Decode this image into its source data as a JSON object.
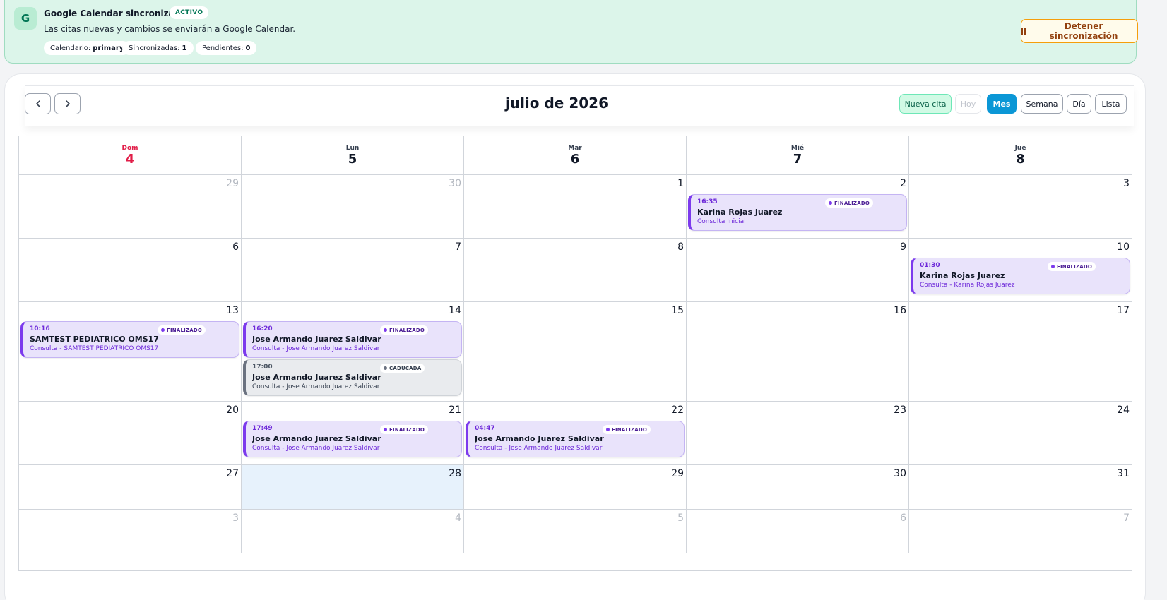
{
  "sync": {
    "avatar_letter": "G",
    "title": "Google Calendar sincronizando",
    "badge": "ACTIVO",
    "description": "Las citas nuevas y cambios se enviarán a Google Calendar.",
    "chips": [
      {
        "label": "Calendario:",
        "value": "primary"
      },
      {
        "label": "Sincronizadas:",
        "value": "1"
      },
      {
        "label": "Pendientes:",
        "value": "0"
      }
    ],
    "stop_label": "Detener sincronización"
  },
  "toolbar": {
    "title": "julio de 2026",
    "new_label": "Nueva cita",
    "today_label": "Hoy",
    "month_label": "Mes",
    "week_label": "Semana",
    "day_label": "Día",
    "list_label": "Lista",
    "active_view": "Mes"
  },
  "colors": {
    "accent": "#0b97d6",
    "sunday": "#e11d48",
    "event_finalized": "#7c3aed",
    "event_expired": "#6b7280",
    "sync_bg": "#dcf5ea",
    "today_bg": "#e7f2fc"
  },
  "icons": {
    "prev": "chevron-left-icon",
    "next": "chevron-right-icon",
    "pause": "pause-icon"
  },
  "calendar": {
    "headers": [
      {
        "dow": "Dom",
        "num": "4"
      },
      {
        "dow": "Lun",
        "num": "5"
      },
      {
        "dow": "Mar",
        "num": "6"
      },
      {
        "dow": "Mié",
        "num": "7"
      },
      {
        "dow": "Jue",
        "num": "8"
      }
    ],
    "weeks": [
      {
        "days": [
          {
            "num": "29",
            "other": true,
            "events": []
          },
          {
            "num": "30",
            "other": true,
            "events": []
          },
          {
            "num": "1",
            "events": []
          },
          {
            "num": "2",
            "events": [
              {
                "time": "16:35",
                "status": "FINALIZADO",
                "name": "Karina Rojas Juarez",
                "desc": "Consulta Inicial",
                "kind": "finalized"
              }
            ]
          },
          {
            "num": "3",
            "events": []
          }
        ]
      },
      {
        "days": [
          {
            "num": "6",
            "events": []
          },
          {
            "num": "7",
            "events": []
          },
          {
            "num": "8",
            "events": []
          },
          {
            "num": "9",
            "events": []
          },
          {
            "num": "10",
            "events": [
              {
                "time": "01:30",
                "status": "FINALIZADO",
                "name": "Karina Rojas Juarez",
                "desc": "Consulta - Karina Rojas Juarez",
                "kind": "finalized"
              }
            ]
          }
        ]
      },
      {
        "days": [
          {
            "num": "13",
            "events": [
              {
                "time": "10:16",
                "status": "FINALIZADO",
                "name": "SAMTEST PEDIATRICO OMS17",
                "desc": "Consulta - SAMTEST PEDIATRICO OMS17",
                "kind": "finalized"
              }
            ]
          },
          {
            "num": "14",
            "events": [
              {
                "time": "16:20",
                "status": "FINALIZADO",
                "name": "Jose Armando Juarez Saldivar",
                "desc": "Consulta - Jose Armando Juarez Saldivar",
                "kind": "finalized"
              },
              {
                "time": "17:00",
                "status": "CADUCADA",
                "name": "Jose Armando Juarez Saldivar",
                "desc": "Consulta - Jose Armando Juarez Saldivar",
                "kind": "expired"
              }
            ]
          },
          {
            "num": "15",
            "events": []
          },
          {
            "num": "16",
            "events": []
          },
          {
            "num": "17",
            "events": []
          }
        ]
      },
      {
        "days": [
          {
            "num": "20",
            "events": []
          },
          {
            "num": "21",
            "events": [
              {
                "time": "17:49",
                "status": "FINALIZADO",
                "name": "Jose Armando Juarez Saldivar",
                "desc": "Consulta - Jose Armando Juarez Saldivar",
                "kind": "finalized"
              }
            ]
          },
          {
            "num": "22",
            "events": [
              {
                "time": "04:47",
                "status": "FINALIZADO",
                "name": "Jose Armando Juarez Saldivar",
                "desc": "Consulta - Jose Armando Juarez Saldivar",
                "kind": "finalized"
              }
            ]
          },
          {
            "num": "23",
            "events": []
          },
          {
            "num": "24",
            "events": []
          }
        ]
      },
      {
        "days": [
          {
            "num": "27",
            "events": []
          },
          {
            "num": "28",
            "today": true,
            "events": []
          },
          {
            "num": "29",
            "events": []
          },
          {
            "num": "30",
            "events": []
          },
          {
            "num": "31",
            "events": []
          }
        ]
      },
      {
        "days": [
          {
            "num": "3",
            "other": true,
            "events": []
          },
          {
            "num": "4",
            "other": true,
            "events": []
          },
          {
            "num": "5",
            "other": true,
            "events": []
          },
          {
            "num": "6",
            "other": true,
            "events": []
          },
          {
            "num": "7",
            "other": true,
            "events": []
          }
        ]
      }
    ]
  }
}
